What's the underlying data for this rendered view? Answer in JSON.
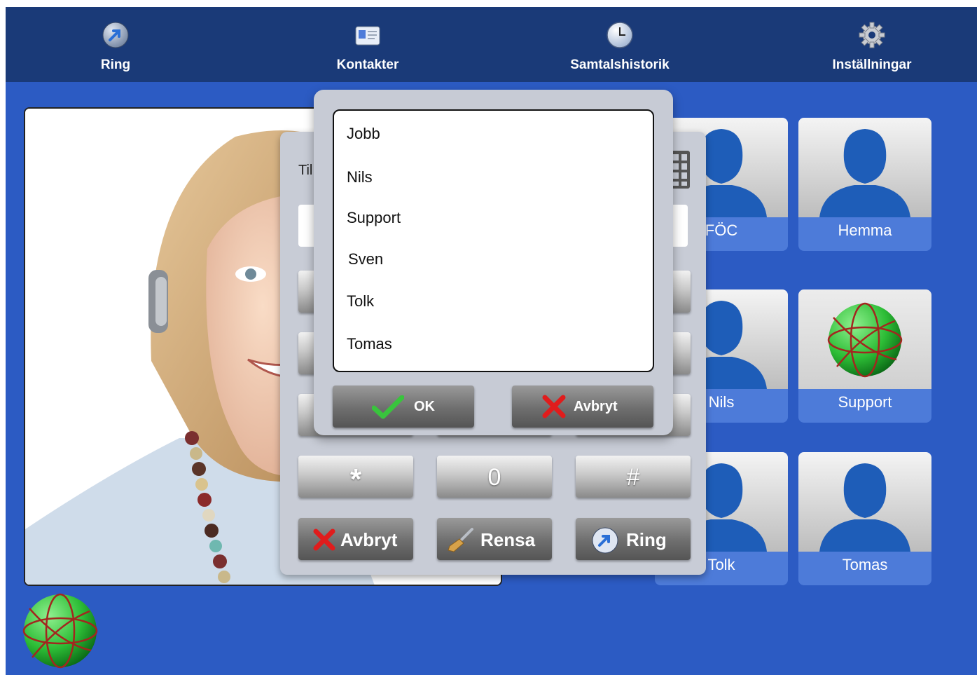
{
  "nav": {
    "items": [
      {
        "label": "Ring",
        "icon": "call-arrow-icon"
      },
      {
        "label": "Kontakter",
        "icon": "contacts-card-icon"
      },
      {
        "label": "Samtalshistorik",
        "icon": "clock-icon"
      },
      {
        "label": "Inställningar",
        "icon": "gear-icon"
      }
    ]
  },
  "contacts": [
    {
      "name": "FÖC"
    },
    {
      "name": "Hemma"
    },
    {
      "name": "Nils"
    },
    {
      "name": "Support"
    },
    {
      "name": "Tolk"
    },
    {
      "name": "Tomas"
    }
  ],
  "dialpad": {
    "title_partial": "Til",
    "keys": {
      "star": "*",
      "zero": "0",
      "hash": "#"
    },
    "actions": {
      "cancel": "Avbryt",
      "clear": "Rensa",
      "call": "Ring"
    }
  },
  "picker": {
    "items": [
      "Jobb",
      "Nils",
      "Support",
      "Sven",
      "Tolk",
      "Tomas"
    ],
    "ok_label": "OK",
    "cancel_label": "Avbryt"
  },
  "colors": {
    "background": "#2c5bc3",
    "navbar": "#1a3a78",
    "tile_label": "#4d7bd9",
    "silhouette": "#1e5db8",
    "globe_green": "#2dbd36"
  }
}
